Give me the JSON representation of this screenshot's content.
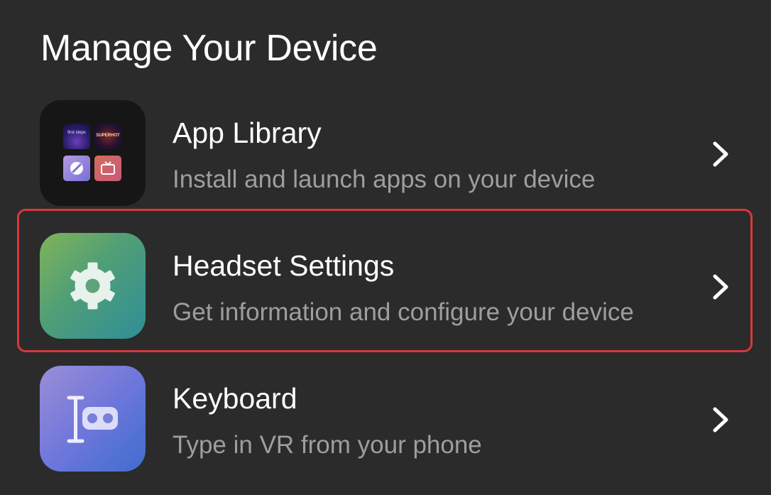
{
  "page": {
    "title": "Manage Your Device"
  },
  "items": [
    {
      "title": "App Library",
      "subtitle": "Install and launch apps on your device",
      "icon": "app-library-icon",
      "thumbnails": [
        {
          "label": "first steps"
        },
        {
          "label": "SUPERHOT"
        },
        {
          "label": ""
        },
        {
          "label": ""
        }
      ]
    },
    {
      "title": "Headset Settings",
      "subtitle": "Get information and configure your device",
      "icon": "gear-icon",
      "highlighted": true
    },
    {
      "title": "Keyboard",
      "subtitle": "Type in VR from your phone",
      "icon": "keyboard-vr-icon"
    }
  ],
  "colors": {
    "background": "#2b2b2b",
    "highlight_border": "#d8393a",
    "subtitle_text": "#9e9e9e"
  }
}
